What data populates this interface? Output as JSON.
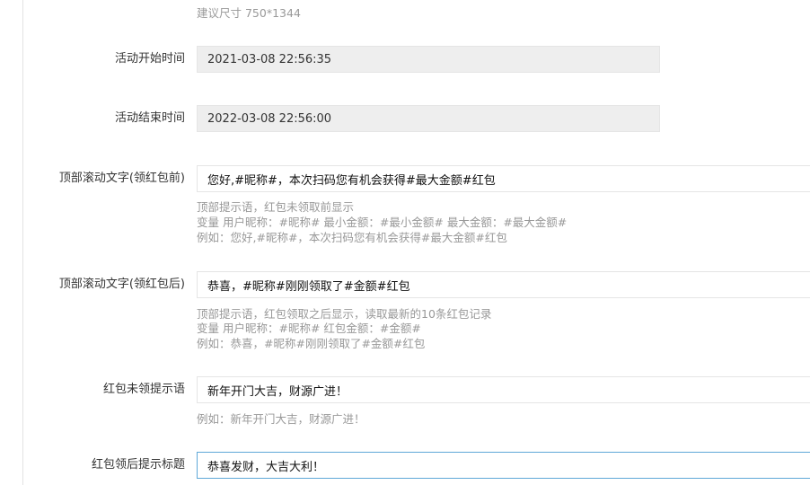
{
  "image_tip": "建议尺寸 750*1344",
  "start_time": {
    "label": "活动开始时间",
    "value": "2021-03-08 22:56:35"
  },
  "end_time": {
    "label": "活动结束时间",
    "value": "2022-03-08 22:56:00"
  },
  "top_scroll_before": {
    "label": "顶部滚动文字(领红包前)",
    "value": "您好,#昵称#，本次扫码您有机会获得#最大金额#红包",
    "help": [
      "顶部提示语，红包未领取前显示",
      "变量 用户昵称：#昵称# 最小金额：#最小金额# 最大金额：#最大金额#",
      "例如：您好,#昵称#，本次扫码您有机会获得#最大金额#红包"
    ]
  },
  "top_scroll_after": {
    "label": "顶部滚动文字(领红包后)",
    "value": "恭喜，#昵称#刚刚领取了#金额#红包",
    "help": [
      "顶部提示语，红包领取之后显示，读取最新的10条红包记录",
      "变量 用户昵称：#昵称# 红包金额：#金额#",
      "例如：恭喜，#昵称#刚刚领取了#金额#红包"
    ]
  },
  "not_received_tip": {
    "label": "红包未领提示语",
    "value": "新年开门大吉，财源广进！",
    "help": "例如：新年开门大吉，财源广进！"
  },
  "received_title": {
    "label": "红包领后提示标题",
    "value": "恭喜发财，大吉大利！"
  }
}
